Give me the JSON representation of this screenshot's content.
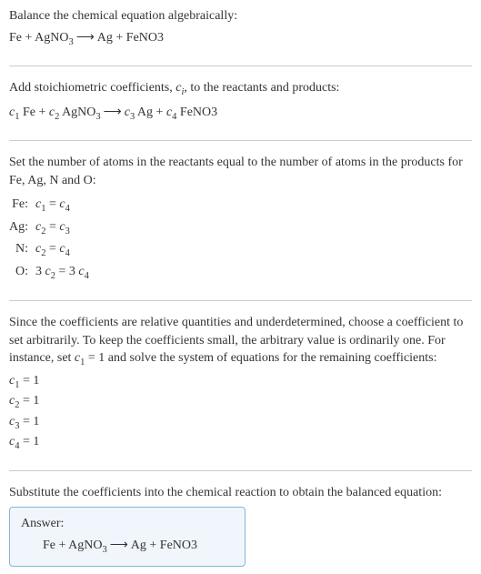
{
  "section1": {
    "instruction": "Balance the chemical equation algebraically:",
    "equation": "Fe + AgNO₃ ⟶ Ag + FeNO3"
  },
  "section2": {
    "instruction_part1": "Add stoichiometric coefficients, ",
    "instruction_ci": "c",
    "instruction_ci_sub": "i",
    "instruction_part2": ", to the reactants and products:",
    "equation": "c₁ Fe + c₂ AgNO₃ ⟶ c₃ Ag + c₄ FeNO3"
  },
  "section3": {
    "instruction": "Set the number of atoms in the reactants equal to the number of atoms in the products for Fe, Ag, N and O:",
    "rows": [
      {
        "label": "Fe:",
        "eq": "c₁ = c₄"
      },
      {
        "label": "Ag:",
        "eq": "c₂ = c₃"
      },
      {
        "label": "N:",
        "eq": "c₂ = c₄"
      },
      {
        "label": "O:",
        "eq": "3 c₂ = 3 c₄"
      }
    ]
  },
  "section4": {
    "instruction": "Since the coefficients are relative quantities and underdetermined, choose a coefficient to set arbitrarily. To keep the coefficients small, the arbitrary value is ordinarily one. For instance, set c₁ = 1 and solve the system of equations for the remaining coefficients:",
    "coeffs": [
      "c₁ = 1",
      "c₂ = 1",
      "c₃ = 1",
      "c₄ = 1"
    ]
  },
  "section5": {
    "instruction": "Substitute the coefficients into the chemical reaction to obtain the balanced equation:",
    "answer_label": "Answer:",
    "answer_eq": "Fe + AgNO₃ ⟶ Ag + FeNO3"
  }
}
